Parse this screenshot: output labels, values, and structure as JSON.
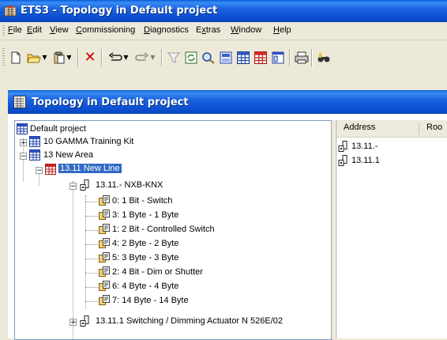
{
  "app": {
    "title": "ETS3 - Topology in Default project",
    "icon": "ets-app-icon"
  },
  "menu": {
    "items": [
      {
        "label": "File",
        "accel": "F"
      },
      {
        "label": "Edit",
        "accel": "E"
      },
      {
        "label": "View",
        "accel": "V"
      },
      {
        "label": "Commissioning",
        "accel": "C"
      },
      {
        "label": "Diagnostics",
        "accel": "D"
      },
      {
        "label": "Extras",
        "accel": "x"
      },
      {
        "label": "Window",
        "accel": "W"
      },
      {
        "label": "Help",
        "accel": "H"
      }
    ]
  },
  "toolbar": {
    "buttons": [
      "new-document-icon",
      "open-folder-icon",
      "paste-icon",
      "delete-icon",
      "undo-icon",
      "redo-icon",
      "filter-icon",
      "refresh-icon",
      "search-icon",
      "view-icon",
      "grid-icon",
      "table-icon",
      "window-icon",
      "print-icon",
      "binoculars-icon"
    ],
    "colors": {
      "delete": "#cc0000",
      "filter": "#9a9a9a"
    }
  },
  "child_window": {
    "title": "Topology in Default project",
    "icon": "topology-icon"
  },
  "tree": {
    "root": {
      "label": "Default project",
      "icon": "project-icon"
    },
    "areas": [
      {
        "label": "10 GAMMA Training Kit",
        "expanded": false,
        "icon": "area-icon"
      },
      {
        "label": "13 New Area",
        "expanded": true,
        "icon": "area-icon"
      }
    ],
    "line": {
      "label": "13.11 New Line",
      "selected": true,
      "icon": "line-icon"
    },
    "device_main": {
      "label": "13.11.- NXB-KNX",
      "expanded": true,
      "icon": "device-icon"
    },
    "objects": [
      {
        "label": "0: 1 Bit - Switch"
      },
      {
        "label": "3: 1 Byte - 1 Byte"
      },
      {
        "label": "1: 2 Bit - Controlled Switch"
      },
      {
        "label": "4: 2 Byte - 2 Byte"
      },
      {
        "label": "5: 3 Byte - 3 Byte"
      },
      {
        "label": "2: 4 Bit - Dim or Shutter"
      },
      {
        "label": "6: 4 Byte - 4 Byte"
      },
      {
        "label": "7: 14 Byte - 14 Byte"
      }
    ],
    "device_second": {
      "label": "13.11.1 Switching / Dimming Actuator N 526E/02",
      "expanded": false,
      "icon": "device-icon"
    }
  },
  "list": {
    "columns": [
      "Address",
      "Roo"
    ],
    "rows": [
      {
        "address": "13.11.-",
        "icon": "device-icon"
      },
      {
        "address": "13.11.1",
        "icon": "device-icon"
      }
    ]
  },
  "colors": {
    "titlebar": "#0a5fd8",
    "selection": "#316ac5",
    "chrome": "#ece9d8"
  }
}
